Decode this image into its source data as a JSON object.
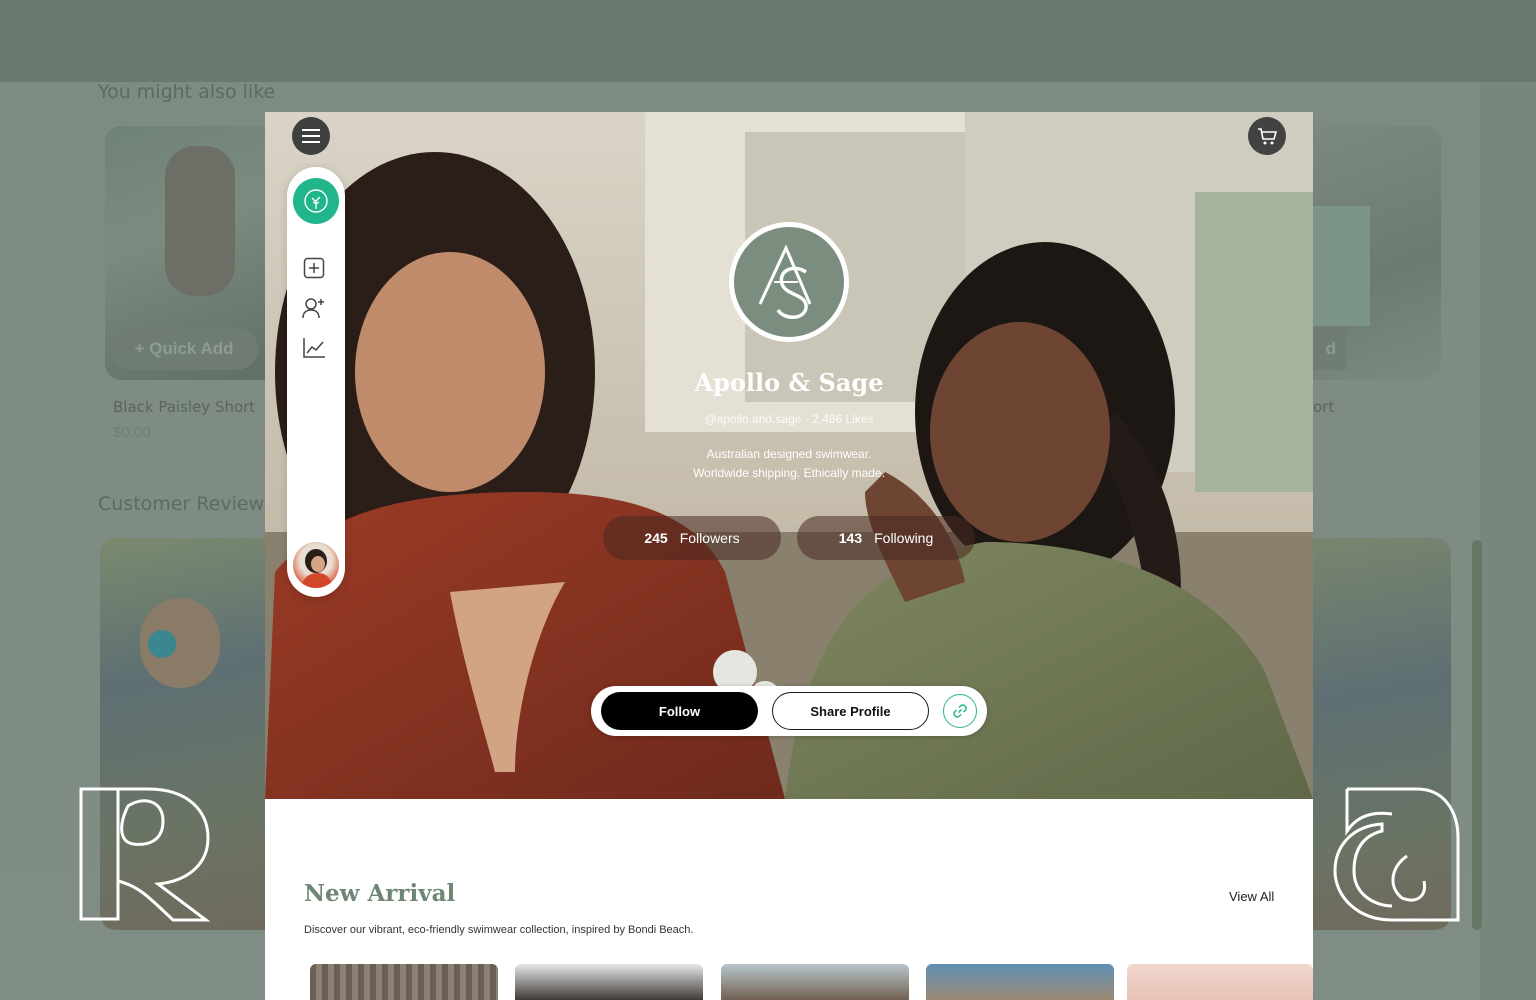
{
  "background": {
    "recommend_heading": "You might also like",
    "reviews_heading": "Customer Reviews",
    "quick_add_label": "+ Quick Add",
    "quick_add_right_label": "d",
    "product_name": "Black Paisley Short",
    "product_name_right": "ort",
    "product_price": "$0.00"
  },
  "header": {
    "menu_icon": "hamburger-menu-icon",
    "cart_icon": "shopping-cart-icon"
  },
  "sidebar": {
    "items": [
      {
        "name": "add-post",
        "icon": "plus-square-icon"
      },
      {
        "name": "add-user",
        "icon": "user-plus-icon"
      },
      {
        "name": "analytics",
        "icon": "line-chart-icon"
      }
    ]
  },
  "profile": {
    "logo_text": "AS",
    "name": "Apollo & Sage",
    "meta": "@apollo.and.sage · 2,486 Likes",
    "bio_line1": "Australian designed swimwear.",
    "bio_line2": "Worldwide shipping. Ethically made.",
    "followers_count": "245",
    "followers_label": "Followers",
    "following_count": "143",
    "following_label": "Following"
  },
  "actions": {
    "follow_label": "Follow",
    "share_label": "Share Profile",
    "link_icon": "link-icon"
  },
  "new_arrival": {
    "title": "New Arrival",
    "description": "Discover our vibrant, eco-friendly swimwear collection, inspired by Bondi Beach.",
    "view_all_label": "View All"
  },
  "colors": {
    "accent_green": "#21b58b",
    "brand_sage": "#7b8d7f",
    "section_title": "#6f8673"
  }
}
